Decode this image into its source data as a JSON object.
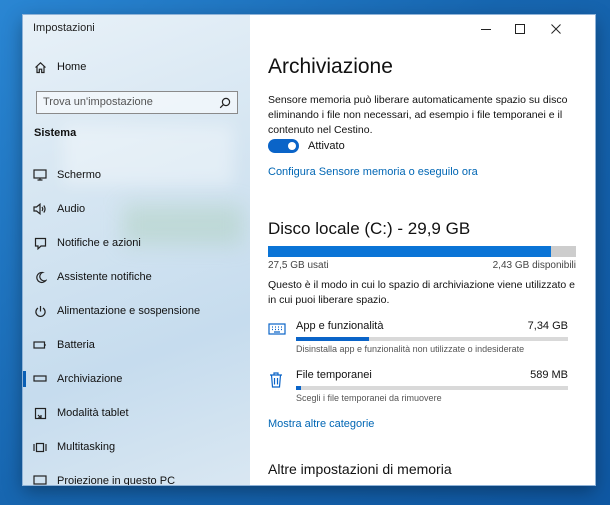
{
  "window": {
    "title": "Impostazioni",
    "controls": {
      "minimize": "—",
      "maximize": "☐",
      "close": "✕"
    }
  },
  "sidebar": {
    "home_label": "Home",
    "search_placeholder": "Trova un'impostazione",
    "section_title": "Sistema",
    "items": [
      {
        "label": "Schermo",
        "icon": "monitor-icon"
      },
      {
        "label": "Audio",
        "icon": "speaker-icon"
      },
      {
        "label": "Notifiche e azioni",
        "icon": "notifications-icon"
      },
      {
        "label": "Assistente notifiche",
        "icon": "moon-icon"
      },
      {
        "label": "Alimentazione e sospensione",
        "icon": "power-icon"
      },
      {
        "label": "Batteria",
        "icon": "battery-icon"
      },
      {
        "label": "Archiviazione",
        "icon": "storage-icon",
        "active": true
      },
      {
        "label": "Modalità tablet",
        "icon": "tablet-icon"
      },
      {
        "label": "Multitasking",
        "icon": "multitasking-icon"
      },
      {
        "label": "Proiezione in questo PC",
        "icon": "projection-icon"
      }
    ]
  },
  "main": {
    "title": "Archiviazione",
    "description": "Sensore memoria può liberare automaticamente spazio su disco eliminando i file non necessari, ad esempio i file temporanei e il contenuto nel Cestino.",
    "toggle": {
      "state_label": "Attivato",
      "on": true
    },
    "configure_link": "Configura Sensore memoria o eseguilo ora",
    "disk": {
      "title": "Disco locale (C:) - 29,9 GB",
      "used_label": "27,5 GB usati",
      "free_label": "2,43 GB disponibili",
      "used_fraction": 0.92
    },
    "usage_description": "Questo è il modo in cui lo spazio di archiviazione viene utilizzato e in cui puoi liberare spazio.",
    "categories": [
      {
        "name": "App e funzionalità",
        "size": "7,34 GB",
        "subtitle": "Disinstalla app e funzionalità non utilizzate o indesiderate",
        "icon": "apps-keyboard-icon",
        "fraction": 0.27
      },
      {
        "name": "File temporanei",
        "size": "589 MB",
        "subtitle": "Scegli i file temporanei da rimuovere",
        "icon": "trash-icon",
        "fraction": 0.02
      }
    ],
    "more_categories_link": "Mostra altre categorie",
    "other_settings_title": "Altre impostazioni di memoria"
  },
  "colors": {
    "accent": "#0a64c8",
    "link": "#0066b4",
    "disk_bar": "#0a74d6"
  }
}
